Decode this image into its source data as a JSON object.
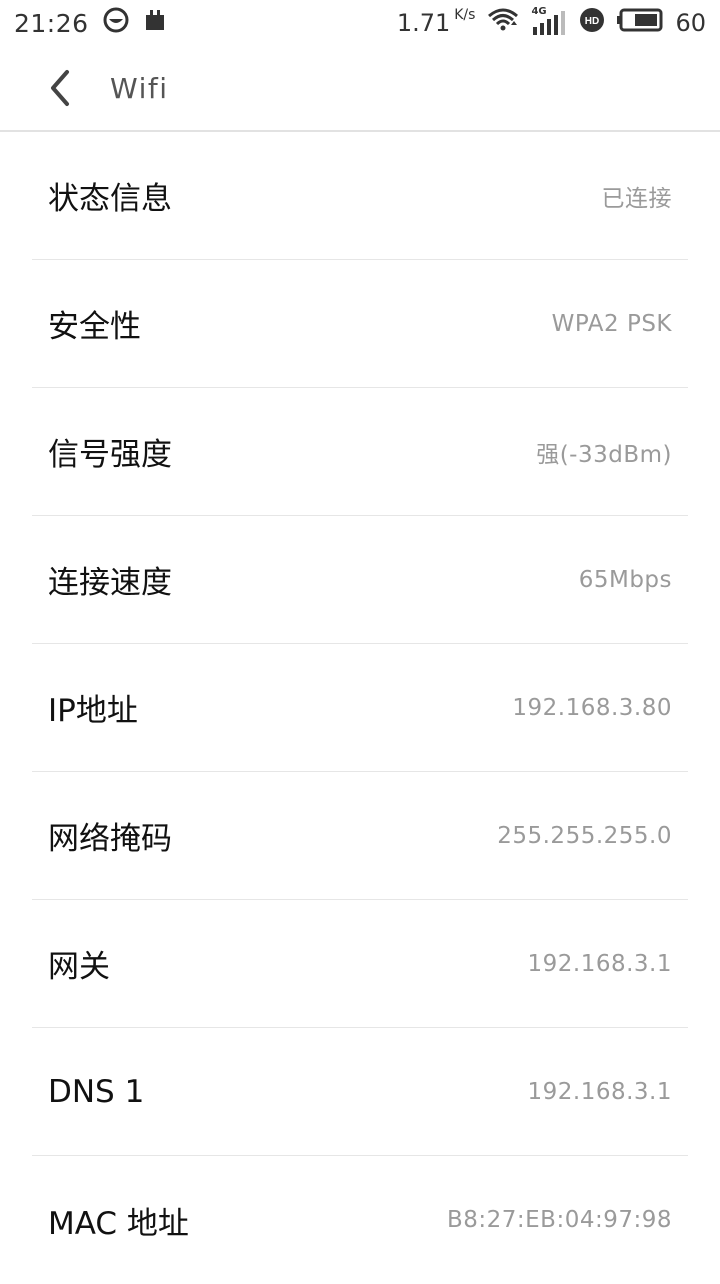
{
  "status_bar": {
    "time": "21:26",
    "net_speed": "1.71",
    "net_speed_unit": "K/s",
    "network_type": "4G",
    "battery_level": "60"
  },
  "header": {
    "title": "Wifi",
    "back_icon": "chevron-left-icon"
  },
  "info": [
    {
      "label": "状态信息",
      "value": "已连接"
    },
    {
      "label": "安全性",
      "value": "WPA2 PSK"
    },
    {
      "label": "信号强度",
      "value": "强(-33dBm)"
    },
    {
      "label": "连接速度",
      "value": "65Mbps"
    },
    {
      "label": "IP地址",
      "value": "192.168.3.80"
    },
    {
      "label": "网络掩码",
      "value": "255.255.255.0"
    },
    {
      "label": "网关",
      "value": "192.168.3.1"
    },
    {
      "label": "DNS 1",
      "value": "192.168.3.1"
    },
    {
      "label": "MAC 地址",
      "value": "B8:27:EB:04:97:98"
    }
  ],
  "colors": {
    "label": "#111111",
    "value": "#9a9a9a",
    "divider": "#e6e6e6"
  }
}
